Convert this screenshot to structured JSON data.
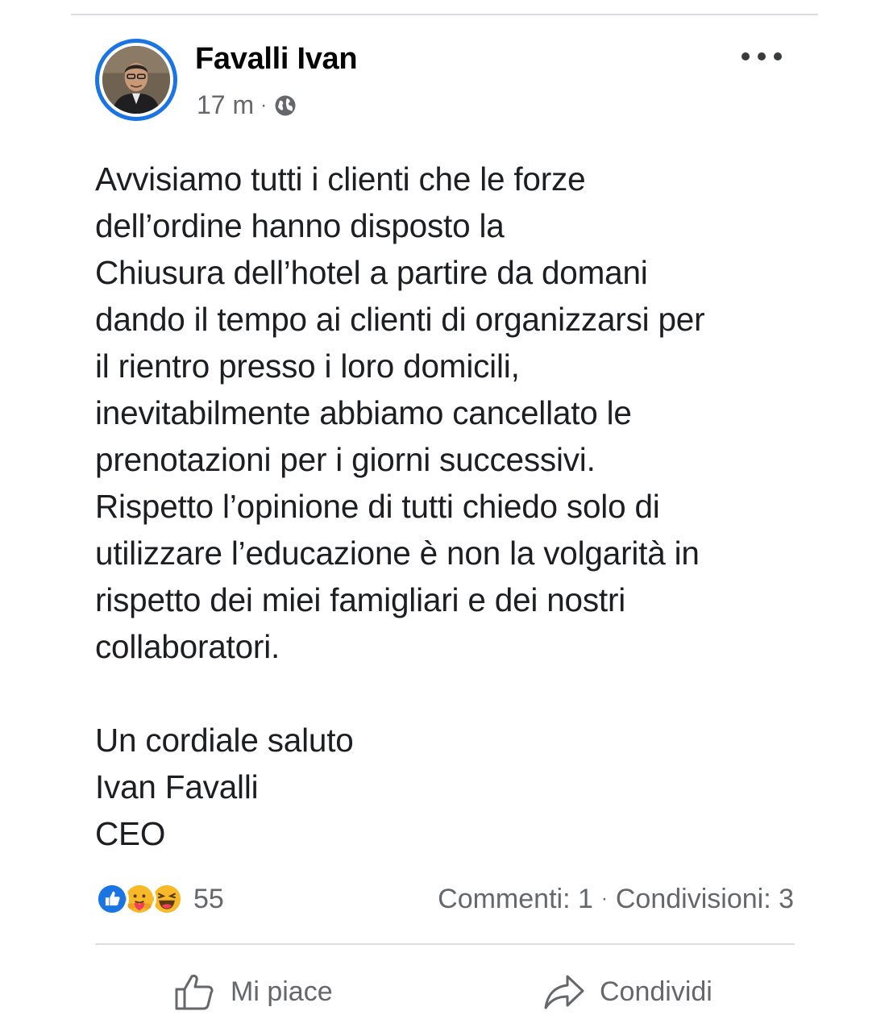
{
  "post": {
    "author": "Favalli Ivan",
    "time": "17 m",
    "meta_separator": "·",
    "privacy_icon": "globe-icon",
    "options_icon": "more-dots-icon",
    "body_lines": [
      "Avvisiamo tutti i clienti che le forze",
      "dell’ordine hanno disposto la",
      "Chiusura dell’hotel a partire da domani",
      "dando il tempo ai clienti di organizzarsi per",
      "il rientro presso i loro domicili,",
      "inevitabilmente abbiamo cancellato le",
      "prenotazioni per i giorni successivi.",
      "Rispetto l’opinione di tutti chiedo solo di",
      "utilizzare l’educazione è non la volgarità in",
      "rispetto dei miei famigliari e dei nostri",
      "collaboratori."
    ],
    "signature_lines": [
      "Un cordiale saluto",
      "Ivan Favalli",
      "CEO"
    ]
  },
  "reactions": {
    "icons": [
      "like-reaction-icon",
      "care-reaction-icon",
      "haha-reaction-icon"
    ],
    "count": "55"
  },
  "stats": {
    "comments": "Commenti: 1",
    "separator": "·",
    "shares": "Condivisioni: 3"
  },
  "actions": {
    "like_label": "Mi piace",
    "share_label": "Condividi"
  },
  "colors": {
    "like_blue": "#1b74e4",
    "reaction_yellow": "#f7b928",
    "secondary_text": "#65676b",
    "divider": "#dadde1"
  }
}
